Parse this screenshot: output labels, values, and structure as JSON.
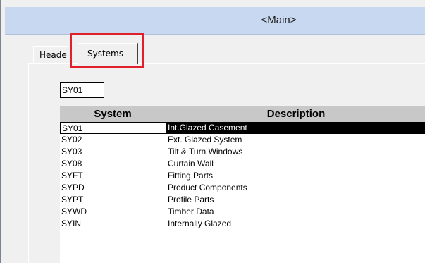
{
  "window": {
    "title": "<Main>"
  },
  "tabs": [
    {
      "label": "Heade"
    },
    {
      "label": "Systems",
      "selected": true
    }
  ],
  "search": {
    "value": "SY01"
  },
  "grid": {
    "columns": [
      "System",
      "Description"
    ],
    "rows": [
      {
        "system": "SY01",
        "description": "Int.Glazed Casement",
        "selected": true
      },
      {
        "system": "SY02",
        "description": "Ext. Glazed System"
      },
      {
        "system": "SY03",
        "description": "Tilt & Turn Windows"
      },
      {
        "system": "SY08",
        "description": "Curtain Wall"
      },
      {
        "system": "SYFT",
        "description": "Fitting Parts"
      },
      {
        "system": "SYPD",
        "description": "Product Components"
      },
      {
        "system": "SYPT",
        "description": "Profile Parts"
      },
      {
        "system": "SYWD",
        "description": "Timber Data"
      },
      {
        "system": "SYIN",
        "description": "Internally Glazed"
      }
    ]
  },
  "colors": {
    "highlight": "#e0202a",
    "selection": "#000000",
    "titlebar": "#c8d8f0"
  }
}
